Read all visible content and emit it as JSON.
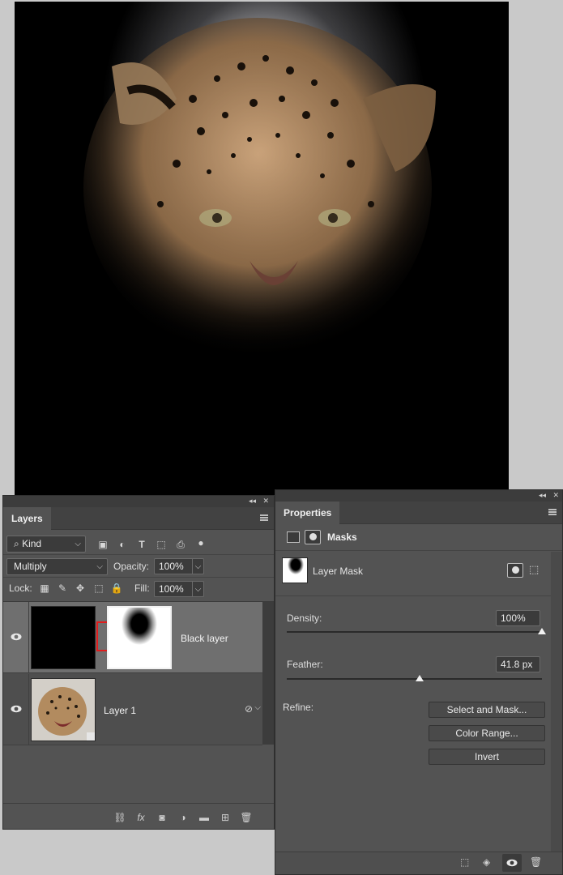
{
  "layers_panel": {
    "tab_label": "Layers",
    "filter": {
      "kind_label": "Kind"
    },
    "blend_mode": "Multiply",
    "opacity_label": "Opacity:",
    "opacity_value": "100%",
    "lock_label": "Lock:",
    "fill_label": "Fill:",
    "fill_value": "100%",
    "layers": [
      {
        "name": "Black layer",
        "visible": true,
        "selected": true
      },
      {
        "name": "Layer 1",
        "visible": true,
        "selected": false
      }
    ]
  },
  "properties_panel": {
    "tab_label": "Properties",
    "section_label": "Masks",
    "mask_type_label": "Layer Mask",
    "density_label": "Density:",
    "density_value": "100%",
    "density_fraction": 1.0,
    "feather_label": "Feather:",
    "feather_value": "41.8 px",
    "feather_fraction": 0.52,
    "refine_label": "Refine:",
    "buttons": {
      "select_and_mask": "Select and Mask...",
      "color_range": "Color Range...",
      "invert": "Invert"
    }
  }
}
